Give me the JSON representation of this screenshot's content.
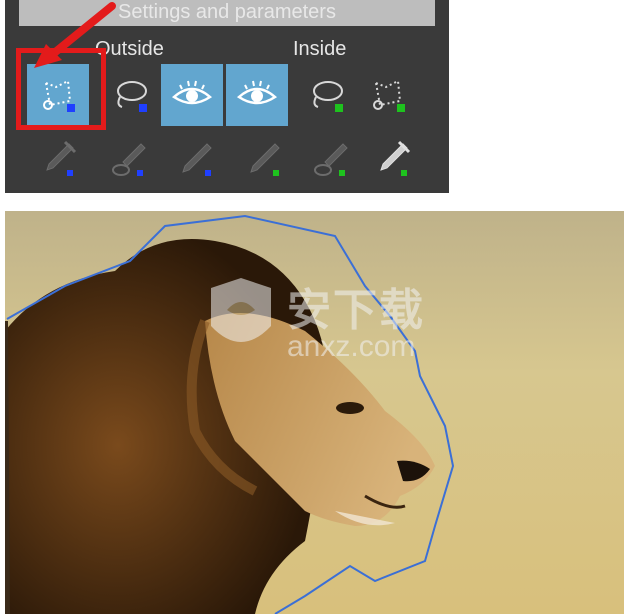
{
  "panel": {
    "header": "Settings and parameters",
    "outside_label": "Outside",
    "inside_label": "Inside"
  },
  "tools": [
    {
      "name": "outside-polygon-lasso-tool",
      "icon": "polygon-lasso-icon",
      "active": true
    },
    {
      "name": "outside-freehand-lasso-tool",
      "icon": "freehand-lasso-icon",
      "active": false
    },
    {
      "name": "outside-visibility-tool",
      "icon": "eye-icon",
      "active": true
    },
    {
      "name": "inside-visibility-tool",
      "icon": "eye-icon",
      "active": true
    },
    {
      "name": "inside-freehand-lasso-tool",
      "icon": "freehand-lasso-icon",
      "active": false
    },
    {
      "name": "inside-polygon-lasso-tool",
      "icon": "polygon-lasso-icon",
      "active": false
    }
  ],
  "colors": {
    "outside_marker": "#1f3fff",
    "inside_marker": "#1ec21e",
    "active_tool": "#62a6cf",
    "highlight": "#e31b1b",
    "selection_outline": "#3b6fd6"
  },
  "watermark": {
    "title": "安下载",
    "url": "anxz.com"
  }
}
